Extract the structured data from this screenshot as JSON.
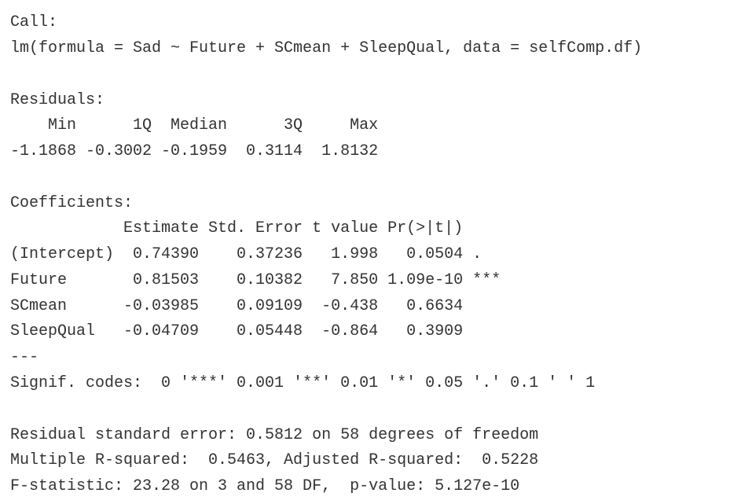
{
  "output": {
    "call_header": "Call:",
    "call": "lm(formula = Sad ~ Future + SCmean + SleepQual, data = selfComp.df)",
    "residuals_header": "Residuals:",
    "residuals_labels": "    Min      1Q  Median      3Q     Max ",
    "residuals_values": "-1.1868 -0.3002 -0.1959  0.3114  1.8132 ",
    "coefficients_header": "Coefficients:",
    "coef_columns": "            Estimate Std. Error t value Pr(>|t|)    ",
    "coef_rows": [
      "(Intercept)  0.74390    0.37236   1.998   0.0504 .  ",
      "Future       0.81503    0.10382   7.850 1.09e-10 ***",
      "SCmean      -0.03985    0.09109  -0.438   0.6634    ",
      "SleepQual   -0.04709    0.05448  -0.864   0.3909    "
    ],
    "separator": "---",
    "signif_codes": "Signif. codes:  0 '***' 0.001 '**' 0.01 '*' 0.05 '.' 0.1 ' ' 1",
    "residual_se": "Residual standard error: 0.5812 on 58 degrees of freedom",
    "r_squared": "Multiple R-squared:  0.5463, Adjusted R-squared:  0.5228 ",
    "f_statistic": "F-statistic: 23.28 on 3 and 58 DF,  p-value: 5.127e-10"
  }
}
